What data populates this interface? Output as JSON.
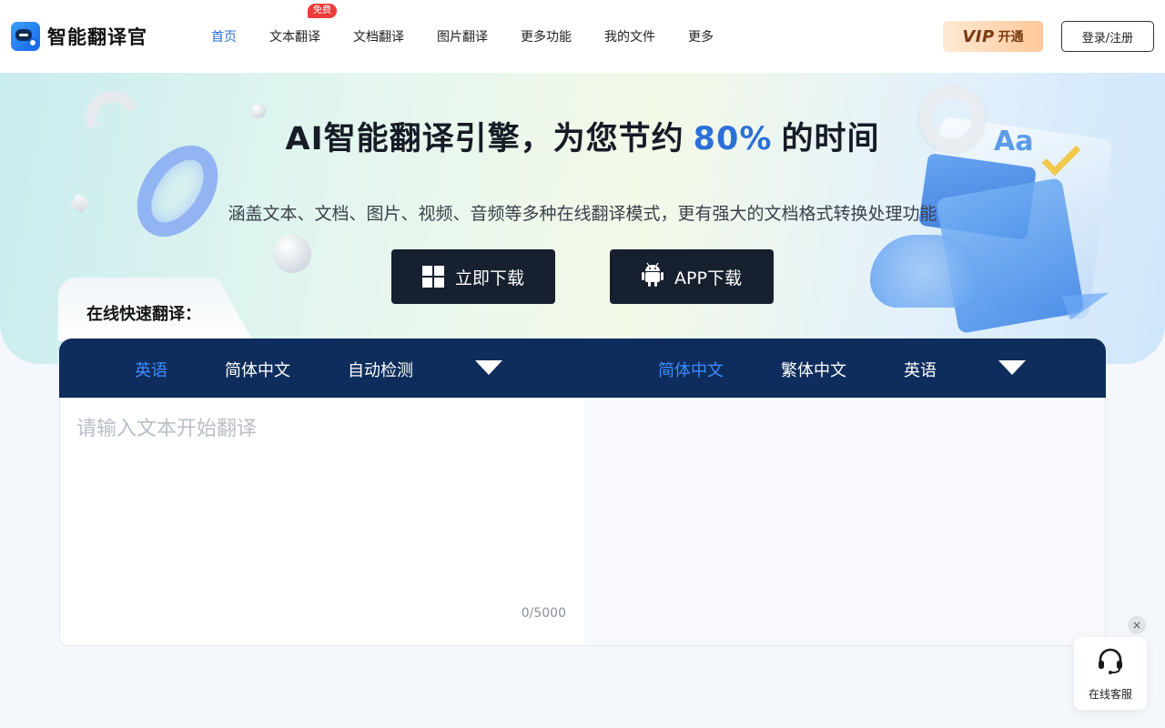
{
  "brand": {
    "name": "智能翻译官"
  },
  "nav": {
    "items": [
      {
        "label": "首页",
        "active": true
      },
      {
        "label": "文本翻译",
        "badge": "免费"
      },
      {
        "label": "文档翻译"
      },
      {
        "label": "图片翻译"
      },
      {
        "label": "更多功能"
      },
      {
        "label": "我的文件"
      },
      {
        "label": "更多"
      }
    ]
  },
  "header": {
    "vip_mark": "VIP",
    "vip_label": "开通",
    "login_label": "登录/注册"
  },
  "hero": {
    "title_prefix": "AI智能翻译引擎，为您节约",
    "title_highlight": "80%",
    "title_suffix": "的时间",
    "subtitle": "涵盖文本、文档、图片、视频、音频等多种在线翻译模式，更有强大的文档格式转换处理功能",
    "download_windows": "立即下载",
    "download_app": "APP下载",
    "deco_text": "Aa"
  },
  "translator": {
    "section_label": "在线快速翻译：",
    "source_langs": [
      "英语",
      "简体中文",
      "自动检测"
    ],
    "target_langs": [
      "简体中文",
      "繁体中文",
      "英语"
    ],
    "input_placeholder": "请输入文本开始翻译",
    "counter": "0/5000"
  },
  "support": {
    "label": "在线客服",
    "close": "×"
  },
  "colors": {
    "accent": "#2b6fd8",
    "lang_bar": "#0f2d5c",
    "button_dark": "#17202f",
    "badge_red": "#ee3b3b"
  }
}
